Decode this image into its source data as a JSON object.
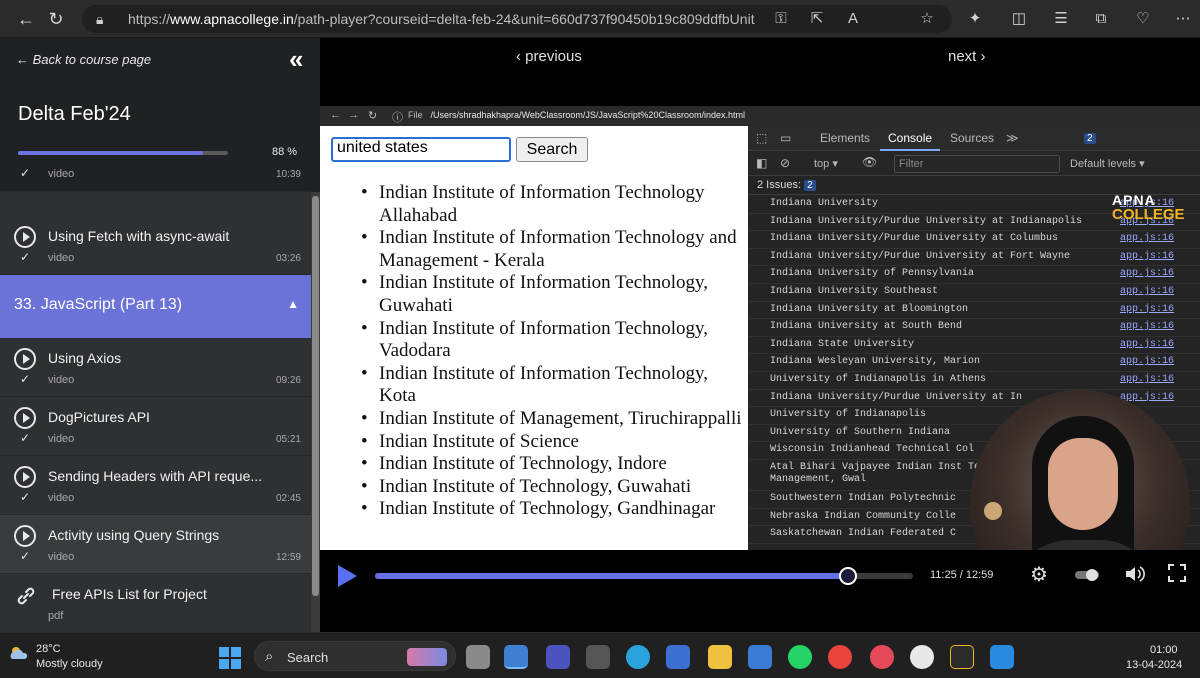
{
  "browser": {
    "url_prefix": "https://",
    "url_domain": "www.apnacollege.in",
    "url_path": "/path-player?courseid=delta-feb-24&unit=660d737f90450b19c809ddfbUnit"
  },
  "sidebar": {
    "back_label": "← Back to course page",
    "course_title": "Delta Feb'24",
    "progress_percent": 88,
    "progress_label": "88 %",
    "lessons_above": [
      {
        "title": "",
        "type": "video",
        "duration": "10:39"
      },
      {
        "title": "Using Fetch with async-await",
        "type": "video",
        "duration": "03:26"
      }
    ],
    "section_title": "33. JavaScript (Part 13)",
    "lessons": [
      {
        "title": "Using Axios",
        "type": "video",
        "duration": "09:26"
      },
      {
        "title": "DogPictures API",
        "type": "video",
        "duration": "05:21"
      },
      {
        "title": "Sending Headers with API reque...",
        "type": "video",
        "duration": "02:45"
      },
      {
        "title": "Activity using Query Strings",
        "type": "video",
        "duration": "12:59"
      },
      {
        "title": "Free APIs List for Project",
        "type": "pdf",
        "duration": ""
      }
    ]
  },
  "player": {
    "previous_label": "‹ previous",
    "next_label": "next ›",
    "time_readout": "11:25 / 12:59",
    "progress_fraction": 0.88
  },
  "video_content": {
    "file_label": "File",
    "inner_url": "/Users/shradhakhapra/WebClassroom/JS/JavaScript%20Classroom/index.html",
    "search_value": "united states",
    "search_button": "Search",
    "universities": [
      "Indian Institute of Information Technology Allahabad",
      "Indian Institute of Information Technology and Management - Kerala",
      "Indian Institute of Information Technology, Guwahati",
      "Indian Institute of Information Technology, Vadodara",
      "Indian Institute of Information Technology, Kota",
      "Indian Institute of Management, Tiruchirappalli",
      "Indian Institute of Science",
      "Indian Institute of Technology, Indore",
      "Indian Institute of Technology, Guwahati",
      "Indian Institute of Technology, Gandhinagar"
    ],
    "devtools": {
      "tabs": [
        "Elements",
        "Console",
        "Sources"
      ],
      "more_tabs": "≫",
      "issues_badge": "2",
      "context": "top ▾",
      "filter_placeholder": "Filter",
      "levels": "Default levels ▾",
      "issues_label": "2 Issues:",
      "issues_count": "2",
      "console_lines": [
        {
          "text": "Indiana University",
          "src": "app.js:16"
        },
        {
          "text": "Indiana University/Purdue University at Indianapolis",
          "src": "app.js:16"
        },
        {
          "text": "Indiana University/Purdue University at Columbus",
          "src": "app.js:16"
        },
        {
          "text": "Indiana University/Purdue University at Fort Wayne",
          "src": "app.js:16"
        },
        {
          "text": "Indiana University of Pennsylvania",
          "src": "app.js:16"
        },
        {
          "text": "Indiana University Southeast",
          "src": "app.js:16"
        },
        {
          "text": "Indiana University at Bloomington",
          "src": "app.js:16"
        },
        {
          "text": "Indiana University at South Bend",
          "src": "app.js:16"
        },
        {
          "text": "Indiana State University",
          "src": "app.js:16"
        },
        {
          "text": "Indiana Wesleyan University, Marion",
          "src": "app.js:16"
        },
        {
          "text": "University of Indianapolis in Athens",
          "src": "app.js:16"
        },
        {
          "text": "Indiana University/Purdue University at In",
          "src": "app.js:16"
        },
        {
          "text": "University of Indianapolis",
          "src": ""
        },
        {
          "text": "University of Southern Indiana",
          "src": ""
        },
        {
          "text": "Wisconsin Indianhead Technical Col",
          "src": ""
        },
        {
          "text": "Atal Bihari Vajpayee Indian Inst Technology and Management, Gwal",
          "src": "",
          "tall": true
        },
        {
          "text": "Southwestern Indian Polytechnic",
          "src": ""
        },
        {
          "text": "Nebraska Indian Community Colle",
          "src": ""
        },
        {
          "text": "Saskatchewan Indian Federated C",
          "src": ""
        }
      ]
    },
    "logo_line1": "APNA",
    "logo_line2": "COLLEGE"
  },
  "taskbar": {
    "temp": "28°C",
    "weather": "Mostly cloudy",
    "search_label": "Search",
    "time": "01:00",
    "date": "13-04-2024"
  }
}
